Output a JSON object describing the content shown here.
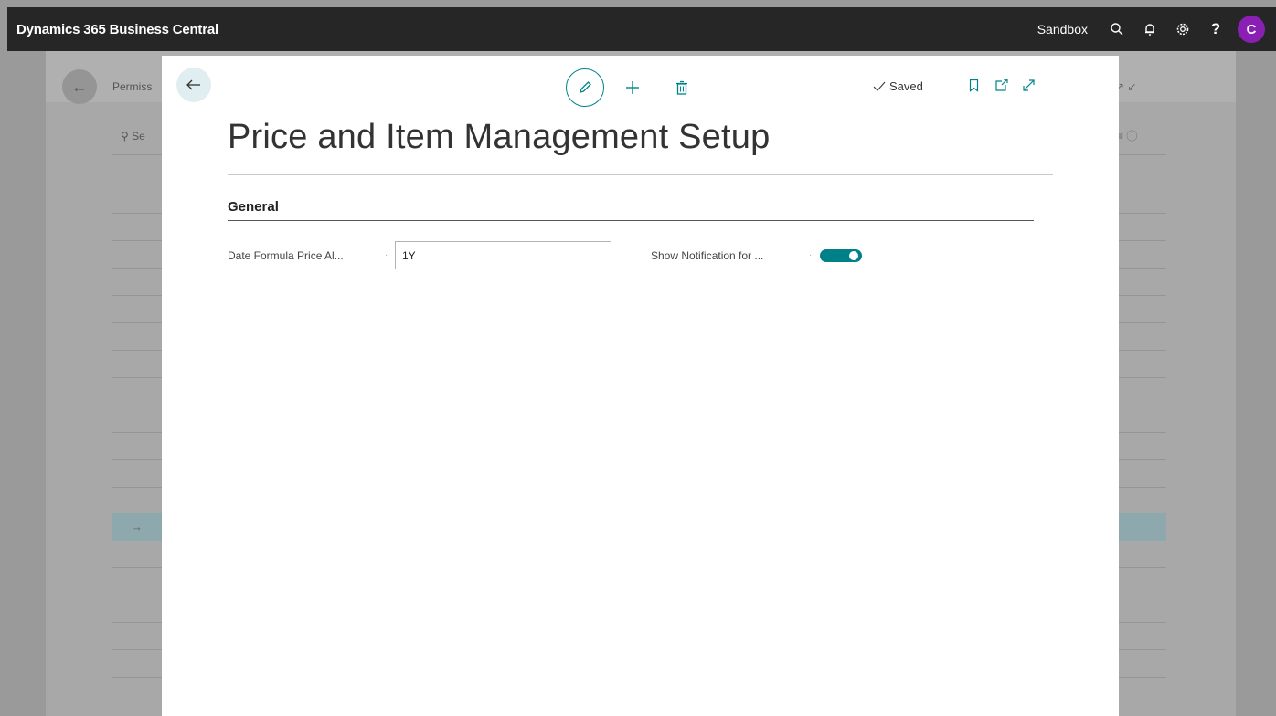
{
  "app": {
    "title": "Dynamics 365 Business Central",
    "environment": "Sandbox",
    "avatar_initial": "C",
    "help_glyph": "?",
    "icons": [
      "search-icon",
      "bell-icon",
      "gear-icon",
      "help-icon"
    ]
  },
  "background_page": {
    "title": "Permiss",
    "search": "Se"
  },
  "dialog": {
    "title": "Price and Item Management Setup",
    "saved_label": "Saved",
    "actions": [
      "edit-icon",
      "add-icon",
      "delete-icon"
    ],
    "window_icons": [
      "bookmark-icon",
      "open-new-window-icon",
      "expand-icon"
    ],
    "section": {
      "title": "General",
      "fields": {
        "date_formula": {
          "label": "Date Formula Price Al...",
          "value": "1Y"
        },
        "show_notification": {
          "label": "Show Notification for ...",
          "value": true
        }
      }
    }
  },
  "colors": {
    "appbar": "#262626",
    "accent": "#008489",
    "avatar": "#8a1fb3"
  }
}
